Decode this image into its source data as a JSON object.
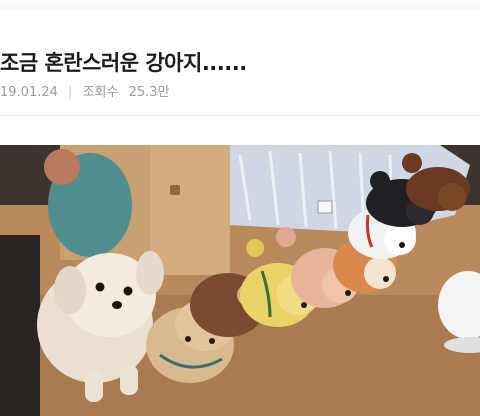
{
  "post": {
    "title": "조금 혼란스러운 강아지......",
    "date": "19.01.24",
    "separator": "|",
    "views_label": "조회수",
    "views_value": "25.3만"
  },
  "photo": {
    "subject": "puppy-among-plush-dogs"
  }
}
